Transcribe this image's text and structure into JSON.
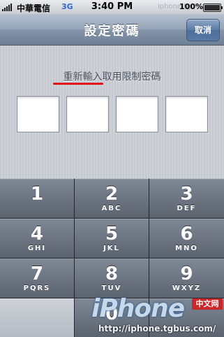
{
  "status_bar": {
    "carrier": "中華電信",
    "network": "3G",
    "time": "3:40 PM",
    "watermark": "iphone.tgbus.com",
    "battery_text": "100%"
  },
  "nav": {
    "title": "設定密碼",
    "cancel_label": "取消"
  },
  "passcode": {
    "prompt": "重新輸入取用限制密碼",
    "underline_color": "#e0111b"
  },
  "keypad": {
    "keys": [
      {
        "num": "1",
        "letters": ""
      },
      {
        "num": "2",
        "letters": "ABC"
      },
      {
        "num": "3",
        "letters": "DEF"
      },
      {
        "num": "4",
        "letters": "GHI"
      },
      {
        "num": "5",
        "letters": "JKL"
      },
      {
        "num": "6",
        "letters": "MNO"
      },
      {
        "num": "7",
        "letters": "PQRS"
      },
      {
        "num": "8",
        "letters": "TUV"
      },
      {
        "num": "9",
        "letters": "WXYZ"
      },
      {
        "num": "",
        "letters": ""
      },
      {
        "num": "0",
        "letters": ""
      },
      {
        "num": "",
        "letters": ""
      }
    ]
  },
  "watermark": {
    "logo": "iPhone",
    "badge": "中文网",
    "url": "http://iphone.tgbus.com/"
  }
}
